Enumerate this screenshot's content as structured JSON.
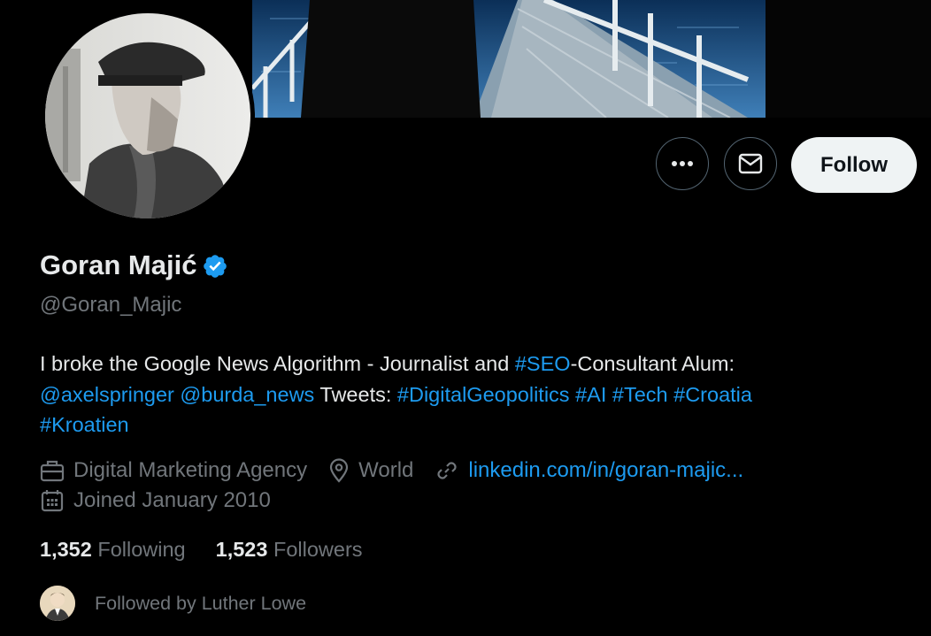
{
  "profile": {
    "display_name": "Goran Majić",
    "handle": "@Goran_Majic",
    "verified": true,
    "bio_parts": {
      "p1": "I broke the Google News Algorithm - Journalist and ",
      "seo": "#SEO",
      "p2": "-Consultant Alum:",
      "axel": "@axelspringer",
      "burda": "@burda_news",
      "tweets": "Tweets:",
      "geo": "#DigitalGeopolitics",
      "ai": "#AI",
      "tech": "#Tech",
      "croatia": "#Croatia",
      "kroatien": "#Kroatien"
    },
    "category": "Digital Marketing Agency",
    "location": "World",
    "website": "linkedin.com/in/goran-majic...",
    "joined": "Joined January 2010",
    "following_count": "1,352",
    "following_label": "Following",
    "followers_count": "1,523",
    "followers_label": "Followers",
    "followed_by": "Followed by Luther Lowe"
  },
  "actions": {
    "follow_label": "Follow",
    "more_icon": "more-icon",
    "message_icon": "mail-icon"
  },
  "colors": {
    "accent": "#1d9bf0",
    "muted": "#71767b",
    "text": "#e7e9ea",
    "background": "#000000"
  }
}
